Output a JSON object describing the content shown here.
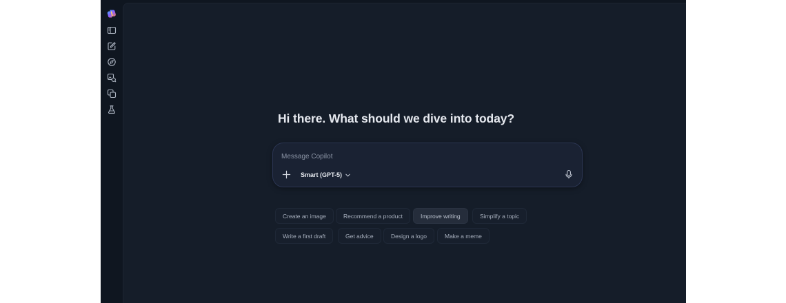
{
  "rail": {
    "items": [
      {
        "name": "copilot-logo"
      },
      {
        "name": "sidebar-toggle-icon"
      },
      {
        "name": "new-chat-icon"
      },
      {
        "name": "discover-icon"
      },
      {
        "name": "imagine-icon"
      },
      {
        "name": "pages-icon"
      },
      {
        "name": "labs-icon"
      }
    ]
  },
  "main": {
    "greeting": "Hi there. What should we dive into today?"
  },
  "composer": {
    "placeholder": "Message Copilot",
    "model_label": "Smart (GPT-5)"
  },
  "suggestions": {
    "row1": [
      "Create an image",
      "Recommend a product",
      "Improve writing",
      "Simplify a topic"
    ],
    "row2": [
      "Write a first draft",
      "Get advice",
      "Design a logo",
      "Make a meme"
    ]
  },
  "colors": {
    "background": "#0f1620",
    "panel": "#151d29",
    "composer": "#1a2233",
    "accent_border": "#2b3552"
  }
}
